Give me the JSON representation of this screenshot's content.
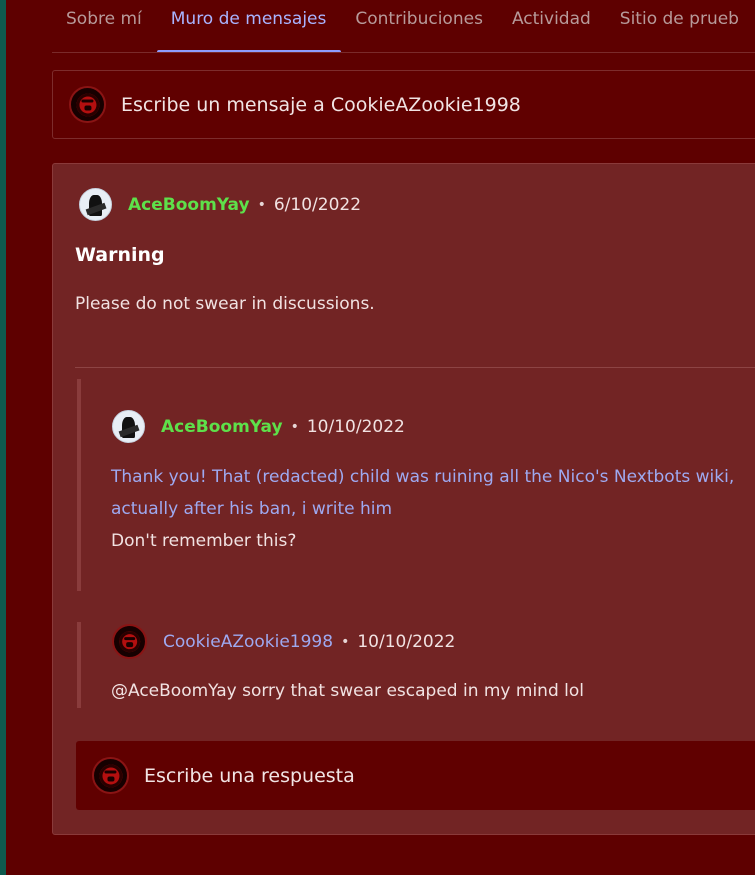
{
  "tabs": [
    {
      "label": "Sobre mí"
    },
    {
      "label": "Muro de mensajes"
    },
    {
      "label": "Contribuciones"
    },
    {
      "label": "Actividad"
    },
    {
      "label": "Sitio de prueb"
    }
  ],
  "compose": {
    "placeholder": "Escribe un mensaje a CookieAZookie1998"
  },
  "thread": {
    "author": "AceBoomYay",
    "separator": "•",
    "date": "6/10/2022",
    "title": "Warning",
    "body": "Please do not swear in discussions.",
    "replies": [
      {
        "author": "AceBoomYay",
        "date": "10/10/2022",
        "quoted_line_1": "Thank you! That (redacted) child was ruining all the Nico's Nextbots wiki,",
        "quoted_line_2": "actually after his ban, i write him",
        "text": "Don't remember this?"
      },
      {
        "author": "CookieAZookie1998",
        "date": "10/10/2022",
        "text": "@AceBoomYay sorry that swear escaped in my mind lol"
      }
    ],
    "reply_placeholder": "Escribe una respuesta"
  },
  "colors": {
    "background": "#5e0000",
    "card": "#722424",
    "accent": "#8e9cff",
    "author_highlight": "#5ee04a"
  }
}
